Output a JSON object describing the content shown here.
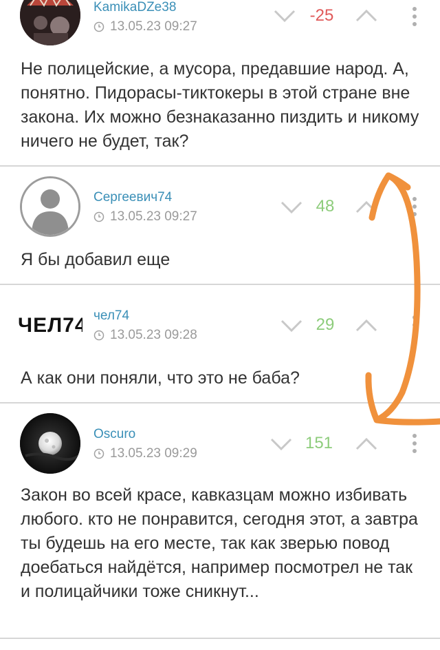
{
  "comments": [
    {
      "username": "KamikaDZe38",
      "timestamp": "13.05.23 09:27",
      "score": "-25",
      "text": "Не полицейские, а мусора, предавшие народ. А, понятно. Пидорасы-тиктокеры в этой стране вне закона. Их можно безнаказанно пиздить и никому ничего не будет, так?"
    },
    {
      "username": "Сергеевич74",
      "timestamp": "13.05.23 09:27",
      "score": "48",
      "text": "Я бы добавил еще"
    },
    {
      "username": "чел74",
      "avatar_text": "ЧЕЛ74",
      "timestamp": "13.05.23 09:28",
      "score": "29",
      "text": "А как они поняли, что это не баба?"
    },
    {
      "username": "Oscuro",
      "timestamp": "13.05.23 09:29",
      "score": "151",
      "text": "Закон во всей красе, кавказцам можно избивать любого. кто не понравится, сегодня этот, а завтра ты будешь на его месте, так как зверью повод доебаться найдётся, например посмотрел не так и полицайчики тоже сникнут..."
    }
  ],
  "icons": {
    "clock": "clock-icon",
    "downvote": "chevron-down-icon",
    "upvote": "chevron-up-icon",
    "more": "more-vertical-icon"
  },
  "colors": {
    "username": "#3a8fb7",
    "score_positive": "#8dcc7b",
    "score_negative": "#e05a5a",
    "annotation_arrow": "#f0913c"
  }
}
